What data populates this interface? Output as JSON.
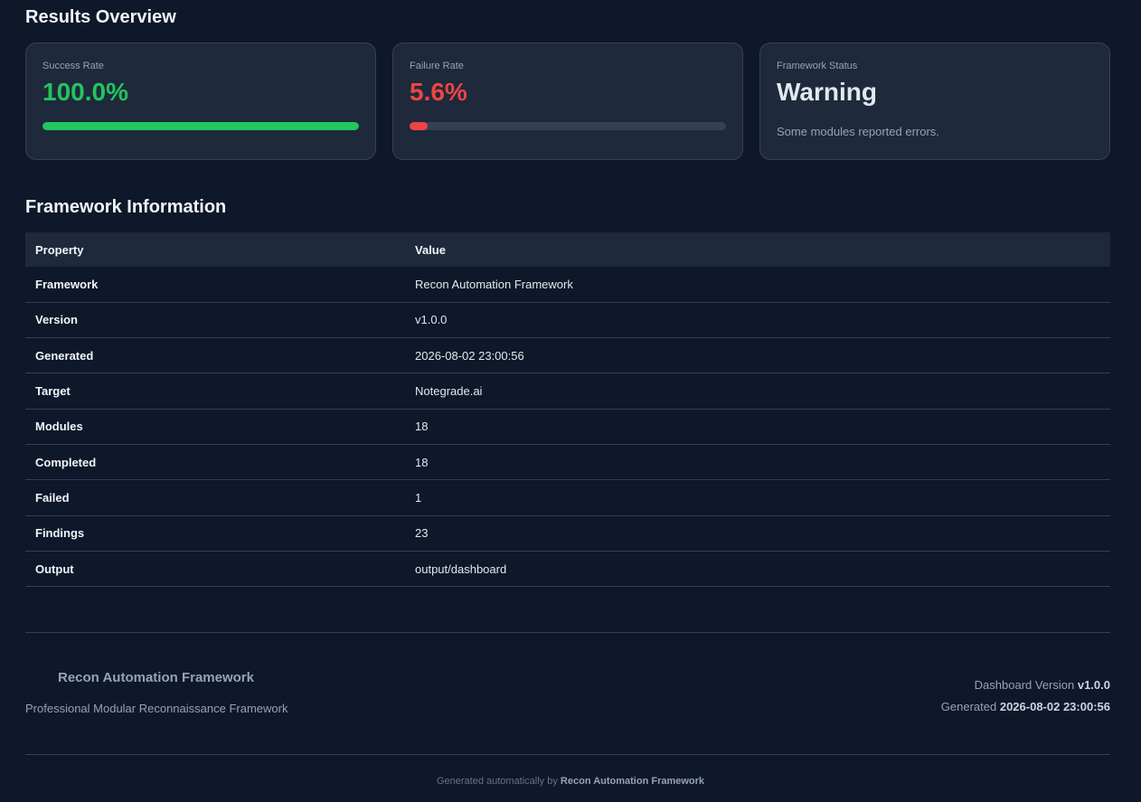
{
  "results": {
    "title": "Results Overview",
    "success": {
      "label": "Success Rate",
      "value": "100.0%",
      "fraction": 1.0,
      "color": "#22c55e"
    },
    "failure": {
      "label": "Failure Rate",
      "value": "5.6%",
      "fraction": 0.056,
      "color": "#ef4444"
    },
    "status": {
      "label": "Framework Status",
      "value": "Warning",
      "note": "Some modules reported errors."
    }
  },
  "info": {
    "title": "Framework Information",
    "headers": [
      "Property",
      "Value"
    ],
    "rows": [
      {
        "property": "Framework",
        "value": "Recon Automation Framework"
      },
      {
        "property": "Version",
        "value": "v1.0.0"
      },
      {
        "property": "Generated",
        "value": "2026-08-02 23:00:56"
      },
      {
        "property": "Target",
        "value": "Notegrade.ai"
      },
      {
        "property": "Modules",
        "value": "18"
      },
      {
        "property": "Completed",
        "value": "18"
      },
      {
        "property": "Failed",
        "value": "1"
      },
      {
        "property": "Findings",
        "value": "23"
      },
      {
        "property": "Output",
        "value": "output/dashboard"
      }
    ]
  },
  "footer": {
    "title": "Recon Automation Framework",
    "subtitle": "Professional Modular Reconnaissance Framework",
    "version_label": "Dashboard Version",
    "version": "v1.0.0",
    "generated_label": "Generated",
    "generated": "2026-08-02 23:00:56",
    "note_prefix": "Generated automatically by",
    "note_name": "Recon Automation Framework"
  }
}
